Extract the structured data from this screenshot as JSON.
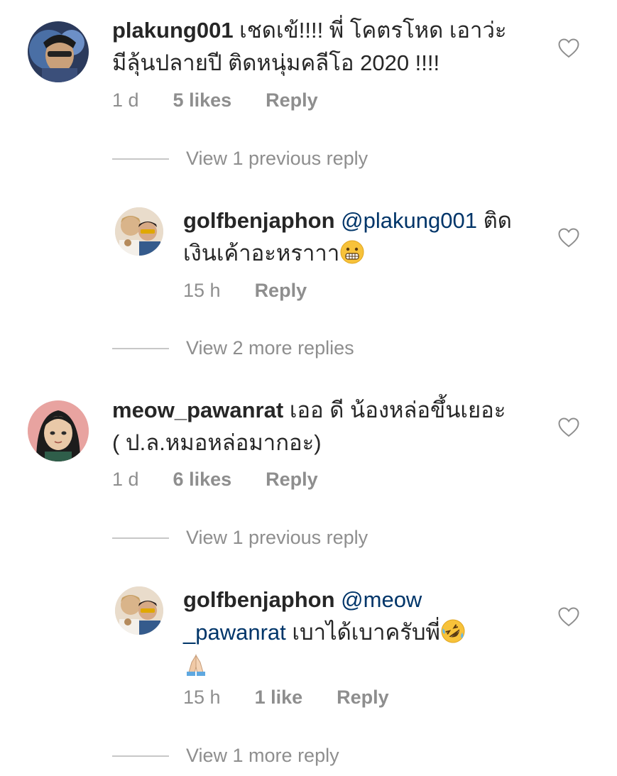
{
  "comments": [
    {
      "username": "plakung001",
      "text_line1": " เชดเข้!!!! พี่ โคตรโหด เอาว่ะ",
      "text_line2": "มีลุ้นปลายปี ติดหนุ่มคลีโอ 2020 !!!!",
      "time": "1 d",
      "likes": "5 likes",
      "reply": "Reply",
      "view_replies": "View 1 previous reply"
    },
    {
      "username": "golfbenjaphon",
      "mention": "@plakung001",
      "text_line1_suffix": " ติด",
      "text_line2": "เงินเค้าอะหราาา",
      "emoji": "grimacing-face-emoji",
      "time": "15 h",
      "reply": "Reply",
      "view_replies": "View 2 more replies"
    },
    {
      "username": "meow_pawanrat",
      "text_line1": " เออ ดี น้องหล่อขึ้นเยอะ",
      "text_line2": "( ป.ล.หมอหล่อมากอะ)",
      "time": "1 d",
      "likes": "6 likes",
      "reply": "Reply",
      "view_replies": "View 1 previous reply"
    },
    {
      "username": "golfbenjaphon",
      "mention_line1": "@meow",
      "mention_line2": "_pawanrat",
      "text_line2_suffix": " เบาได้เบาครับพี่",
      "emoji1": "rolling-on-floor-laughing-emoji",
      "emoji2": "folded-hands-emoji",
      "time": "15 h",
      "likes": "1 like",
      "reply": "Reply",
      "view_replies": "View 1 more reply"
    }
  ],
  "colors": {
    "text": "#262626",
    "muted": "#8e8e8e",
    "mention": "#003569",
    "divider": "#c7c7c7"
  }
}
